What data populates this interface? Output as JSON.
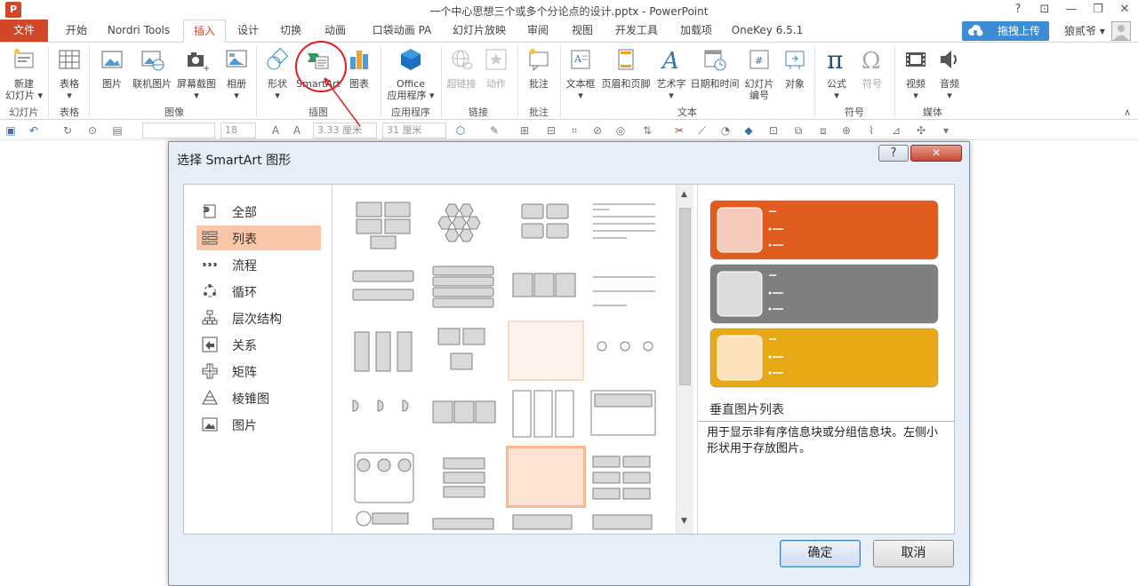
{
  "window": {
    "title": "一个中心思想三个或多个分论点的设计.pptx - PowerPoint",
    "controls": [
      "?",
      "⊡",
      "—",
      "❐",
      "✕"
    ]
  },
  "tabs": {
    "file": "文件",
    "items": [
      "开始",
      "Nordri Tools",
      "插入",
      "设计",
      "切换",
      "动画",
      "口袋动画 PA",
      "幻灯片放映",
      "审阅",
      "视图",
      "开发工具",
      "加载项",
      "OneKey 6.5.1"
    ],
    "active": "插入"
  },
  "account": {
    "upload_label": "拖拽上传",
    "user_name": "狼贰爷 ▾"
  },
  "ribbon": {
    "new_slide": "新建\n幻灯片 ▾",
    "table": "表格\n▾",
    "picture": "图片",
    "online_picture": "联机图片",
    "screenshot": "屏幕截图\n▾",
    "album": "相册\n▾",
    "shapes": "形状\n▾",
    "smartart": "SmartArt",
    "chart": "图表",
    "office_apps": "Office\n应用程序 ▾",
    "hyperlink": "超链接",
    "action": "动作",
    "comment": "批注",
    "textbox": "文本框\n▾",
    "header_footer": "页眉和页脚",
    "wordart": "艺术字\n▾",
    "datetime": "日期和时间",
    "slide_number": "幻灯片\n编号",
    "object": "对象",
    "equation": "公式\n▾",
    "symbol": "符号",
    "video": "视频\n▾",
    "audio": "音频\n▾",
    "groups": {
      "slides": "幻灯片",
      "tables": "表格",
      "images": "图像",
      "illustrations": "插图",
      "apps": "应用程序",
      "links": "链接",
      "comments": "批注",
      "text": "文本",
      "symbols": "符号",
      "media": "媒体"
    }
  },
  "format_bar": {
    "font_size": "18",
    "width_value": "3.33 厘米",
    "height_value": "31 厘米"
  },
  "dialog": {
    "title": "选择 SmartArt 图形",
    "help": "?",
    "close": "✕",
    "categories": [
      {
        "label": "全部"
      },
      {
        "label": "列表"
      },
      {
        "label": "流程"
      },
      {
        "label": "循环"
      },
      {
        "label": "层次结构"
      },
      {
        "label": "关系"
      },
      {
        "label": "矩阵"
      },
      {
        "label": "棱锥图"
      },
      {
        "label": "图片"
      }
    ],
    "selected_category": "列表",
    "preview_name": "垂直图片列表",
    "preview_description": "用于显示非有序信息块或分组信息块。左侧小形状用于存放图片。",
    "ok": "确定",
    "cancel": "取消",
    "preview_colors": [
      "#e05c1c",
      "#7f7f7f",
      "#e7a915"
    ]
  }
}
